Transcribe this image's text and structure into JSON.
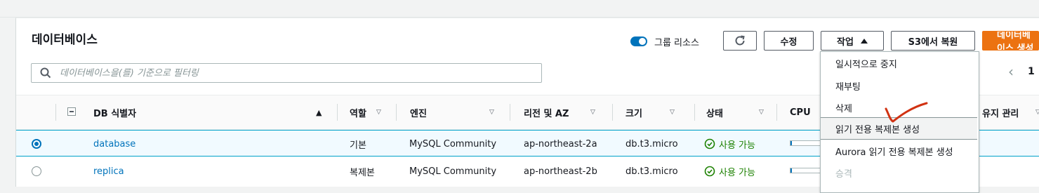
{
  "page": {
    "title": "데이터베이스"
  },
  "toolbar": {
    "group_toggle_label": "그룹 리소스",
    "refresh_icon": "refresh-icon",
    "modify_label": "수정",
    "actions_label": "작업",
    "restore_s3_label": "S3에서 복원",
    "create_label": "데이터베이스 생성"
  },
  "search": {
    "placeholder": "데이터베이스을(를) 기준으로 필터링"
  },
  "pagination": {
    "current_page": "1"
  },
  "table": {
    "columns": {
      "db_id": "DB 식별자",
      "role": "역할",
      "engine": "엔진",
      "region": "리전 및 AZ",
      "size": "크기",
      "status": "상태",
      "cpu": "CPU",
      "maintenance": "유지 관리"
    },
    "rows": [
      {
        "id": "database",
        "role": "기본",
        "engine": "MySQL Community",
        "region": "ap-northeast-2a",
        "size": "db.t3.micro",
        "status": "사용 가능",
        "selected": true
      },
      {
        "id": "replica",
        "role": "복제본",
        "engine": "MySQL Community",
        "region": "ap-northeast-2b",
        "size": "db.t3.micro",
        "status": "사용 가능",
        "selected": false
      }
    ]
  },
  "actions_menu": {
    "items": [
      {
        "label": "일시적으로 중지"
      },
      {
        "label": "재부팅"
      },
      {
        "label": "삭제"
      },
      {
        "label": "읽기 전용 복제본 생성"
      },
      {
        "label": "Aurora 읽기 전용 복제본 생성"
      },
      {
        "label": "승격"
      }
    ]
  },
  "colors": {
    "accent": "#0073bb",
    "primary_button": "#ec7211",
    "status_ok": "#1d8102",
    "annotation": "#d13212"
  }
}
